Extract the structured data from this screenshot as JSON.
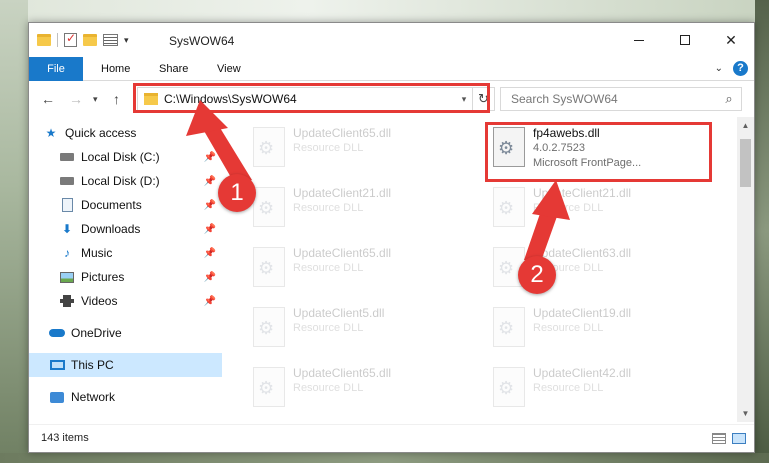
{
  "window": {
    "title": "SysWOW64"
  },
  "ribbon": {
    "tabs": [
      "File",
      "Home",
      "Share",
      "View"
    ],
    "help_label": "?"
  },
  "nav": {
    "address_value": "C:\\Windows\\SysWOW64",
    "search_placeholder": "Search SysWOW64"
  },
  "sidebar": {
    "items": [
      {
        "label": "Quick access",
        "icon": "star-icon"
      },
      {
        "label": "Local Disk (C:)",
        "icon": "drive-icon",
        "pinned": true
      },
      {
        "label": "Local Disk (D:)",
        "icon": "drive-icon",
        "pinned": true
      },
      {
        "label": "Documents",
        "icon": "documents-icon",
        "pinned": true
      },
      {
        "label": "Downloads",
        "icon": "downloads-icon",
        "pinned": true
      },
      {
        "label": "Music",
        "icon": "music-icon",
        "pinned": true
      },
      {
        "label": "Pictures",
        "icon": "pictures-icon",
        "pinned": true
      },
      {
        "label": "Videos",
        "icon": "videos-icon",
        "pinned": true
      },
      {
        "label": "OneDrive",
        "icon": "cloud-icon"
      },
      {
        "label": "This PC",
        "icon": "computer-icon",
        "selected": true
      },
      {
        "label": "Network",
        "icon": "network-icon"
      }
    ]
  },
  "files": [
    {
      "name": "UpdateClient65.dll",
      "type": "Resource DLL"
    },
    {
      "name": "fp4awebs.dll",
      "version": "4.0.2.7523",
      "type": "Microsoft FrontPage...",
      "highlighted": true
    },
    {
      "name": "UpdateClient21.dll",
      "type": "Resource DLL"
    },
    {
      "name": "UpdateClient21.dll",
      "type": "Resource DLL"
    },
    {
      "name": "UpdateClient65.dll",
      "type": "Resource DLL"
    },
    {
      "name": "UpdateClient63.dll",
      "type": "Resource DLL"
    },
    {
      "name": "UpdateClient5.dll",
      "type": "Resource DLL"
    },
    {
      "name": "UpdateClient19.dll",
      "type": "Resource DLL"
    },
    {
      "name": "UpdateClient65.dll",
      "type": "Resource DLL"
    },
    {
      "name": "UpdateClient42.dll",
      "type": "Resource DLL"
    }
  ],
  "status": {
    "item_count": "143 items"
  },
  "annotations": {
    "step1": "1",
    "step2": "2",
    "color": "#e53935"
  }
}
